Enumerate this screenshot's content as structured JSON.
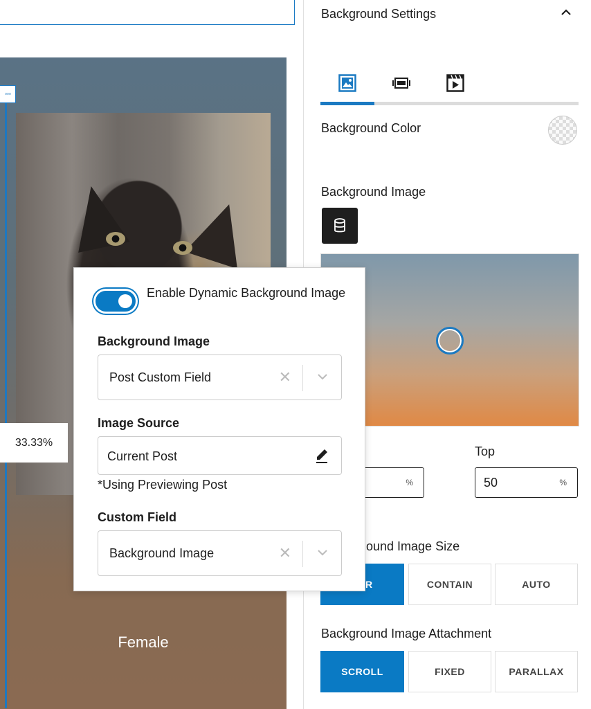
{
  "canvas": {
    "width_badge": "33.33%",
    "caption": "Female",
    "handle_glyph": "◦◦◦"
  },
  "sidebar": {
    "panel_title": "Background Settings",
    "tabs": [
      {
        "name": "image-tab",
        "icon": "image-icon",
        "active": true
      },
      {
        "name": "gradient-tab",
        "icon": "slides-icon",
        "active": false
      },
      {
        "name": "video-tab",
        "icon": "video-icon",
        "active": false
      }
    ],
    "bg_color_label": "Background Color",
    "bg_image_label": "Background Image",
    "focal": {
      "top_label": "Top",
      "left_unit": "%",
      "top_value": "50",
      "top_unit": "%"
    },
    "size_label": "Background Image Size",
    "size_label_visible": "ound Image Size",
    "size_options": [
      "YER",
      "CONTAIN",
      "AUTO"
    ],
    "size_selected": "COVER",
    "attachment_label": "Background Image Attachment",
    "attachment_options": [
      "SCROLL",
      "FIXED",
      "PARALLAX"
    ],
    "attachment_selected": "SCROLL",
    "accent_color": "#0a7ac4"
  },
  "popover": {
    "toggle_label": "Enable Dynamic Background Image",
    "toggle_on": true,
    "bg_image_label": "Background Image",
    "bg_image_value": "Post Custom Field",
    "source_label": "Image Source",
    "source_value": "Current Post",
    "source_note": "*Using Previewing Post",
    "custom_field_label": "Custom Field",
    "custom_field_value": "Background Image",
    "clear_glyph": "✕"
  }
}
